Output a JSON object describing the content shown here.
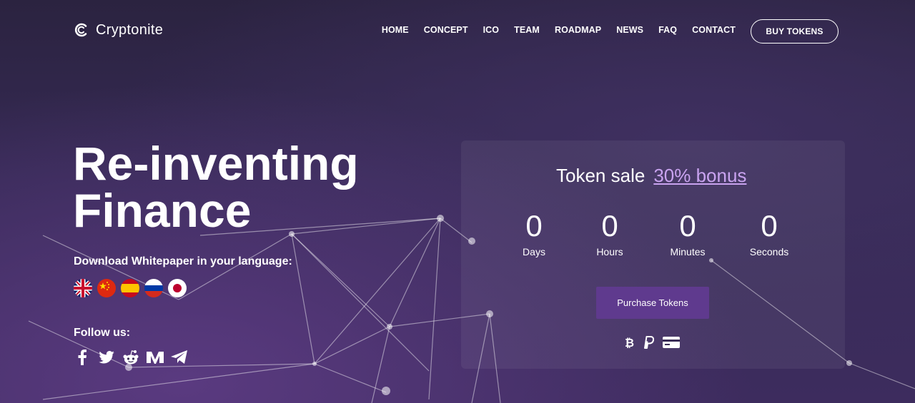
{
  "brand": {
    "name": "Cryptonite",
    "icon": "logo-c-icon"
  },
  "nav": {
    "items": [
      "HOME",
      "CONCEPT",
      "ICO",
      "TEAM",
      "ROADMAP",
      "NEWS",
      "FAQ",
      "CONTACT"
    ],
    "cta": "BUY TOKENS"
  },
  "hero": {
    "title_line1": "Re-inventing",
    "title_line2": "Finance",
    "whitepaper_label": "Download Whitepaper in your language:",
    "languages": [
      {
        "flag": "uk-flag-icon"
      },
      {
        "flag": "china-flag-icon"
      },
      {
        "flag": "spain-flag-icon"
      },
      {
        "flag": "russia-flag-icon"
      },
      {
        "flag": "japan-flag-icon"
      }
    ],
    "follow_label": "Follow us:",
    "socials": [
      "facebook-icon",
      "twitter-icon",
      "reddit-icon",
      "medium-icon",
      "telegram-icon"
    ]
  },
  "sale": {
    "title": "Token sale",
    "bonus": "30% bonus",
    "countdown": [
      {
        "value": "0",
        "label": "Days"
      },
      {
        "value": "0",
        "label": "Hours"
      },
      {
        "value": "0",
        "label": "Minutes"
      },
      {
        "value": "0",
        "label": "Seconds"
      }
    ],
    "button": "Purchase Tokens",
    "payment_icons": [
      "bitcoin-icon",
      "paypal-icon",
      "credit-card-icon"
    ]
  },
  "colors": {
    "accent": "#5f3a8e",
    "bonus": "#c9a3f0",
    "background": "#30264a"
  }
}
